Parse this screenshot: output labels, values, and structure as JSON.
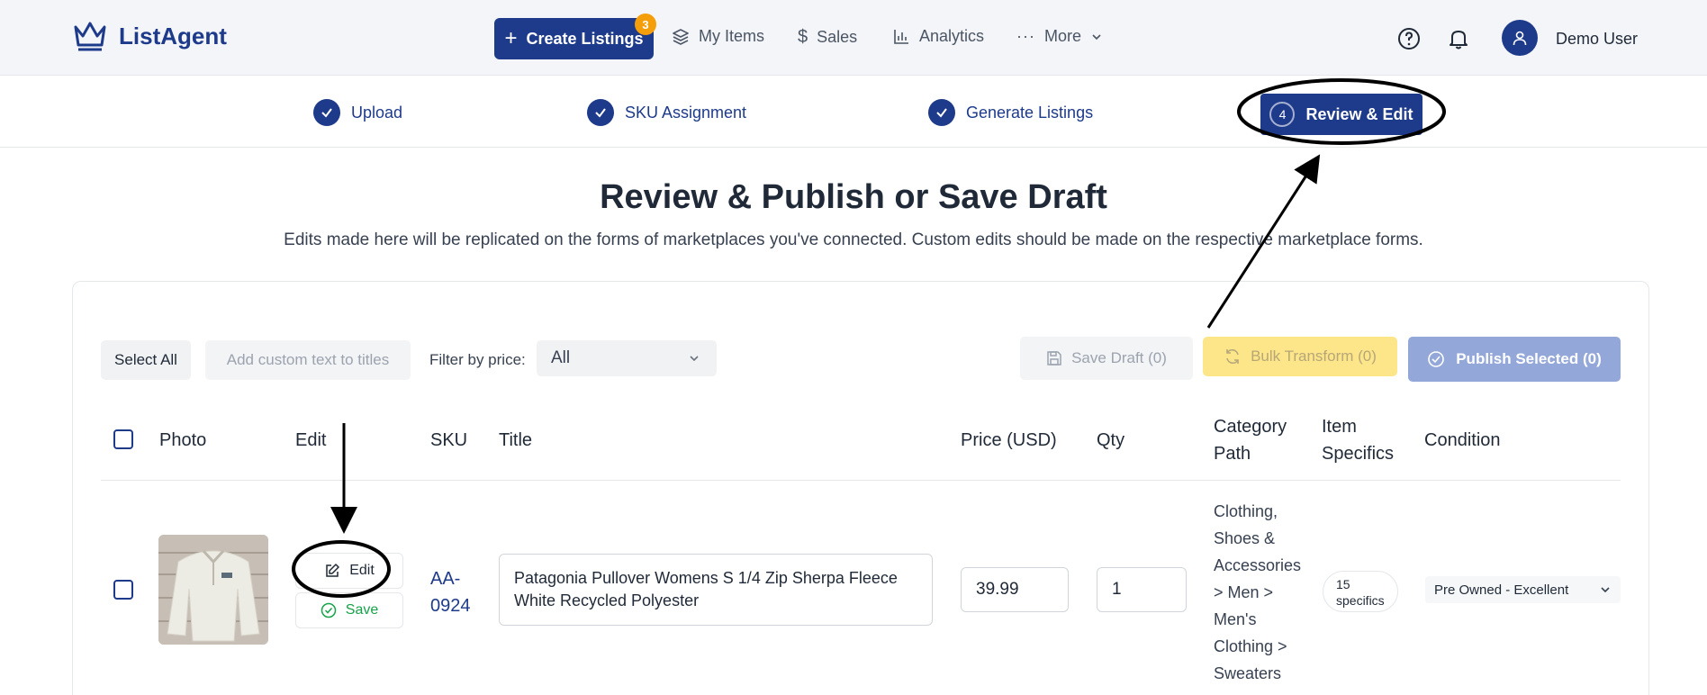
{
  "nav": {
    "brand": "ListAgent",
    "create_label": "Create Listings",
    "create_badge": "3",
    "items": [
      {
        "label": "My Items",
        "icon": "layers-icon"
      },
      {
        "label": "Sales",
        "icon": "dollar-icon"
      },
      {
        "label": "Analytics",
        "icon": "bar-chart-icon"
      },
      {
        "label": "More",
        "icon": "ellipsis-icon"
      }
    ],
    "user_name": "Demo User"
  },
  "stepper": {
    "steps": [
      {
        "label": "Upload",
        "state": "complete"
      },
      {
        "label": "SKU Assignment",
        "state": "complete"
      },
      {
        "label": "Generate Listings",
        "state": "complete"
      },
      {
        "label": "Review & Edit",
        "state": "active",
        "number": "4"
      }
    ]
  },
  "page": {
    "title": "Review & Publish or Save Draft",
    "subtitle": "Edits made here will be replicated on the forms of marketplaces you've connected. Custom edits should be made on the respective marketplace forms."
  },
  "toolbar": {
    "select_all": "Select All",
    "custom_text": "Add custom text to titles",
    "filter_label": "Filter by price:",
    "filter_value": "All",
    "save_draft": "Save Draft (0)",
    "bulk_transform": "Bulk Transform (0)",
    "publish_selected": "Publish Selected (0)"
  },
  "table": {
    "headers": {
      "photo": "Photo",
      "edit": "Edit",
      "sku": "SKU",
      "title": "Title",
      "price": "Price (USD)",
      "qty": "Qty",
      "category_1": "Category",
      "category_2": "Path",
      "specifics_1": "Item",
      "specifics_2": "Specifics",
      "condition": "Condition"
    },
    "rows": [
      {
        "edit_label": "Edit",
        "save_label": "Save",
        "sku_1": "AA-",
        "sku_2": "0924",
        "title": "Patagonia Pullover Womens S 1/4 Zip Sherpa Fleece White Recycled Polyester",
        "price": "39.99",
        "qty": "1",
        "category_lines": [
          "Clothing,",
          "Shoes &",
          "Accessories",
          "> Men >",
          "Men's",
          "Clothing >",
          "Sweaters"
        ],
        "specifics_1": "15",
        "specifics_2": "specifics",
        "condition": "Pre Owned - Excellent"
      }
    ]
  },
  "colors": {
    "primary": "#1e3a8a",
    "badge": "#f59e0b",
    "bulk": "#fde68a",
    "publish": "#93a7d8",
    "save": "#16a34a"
  }
}
